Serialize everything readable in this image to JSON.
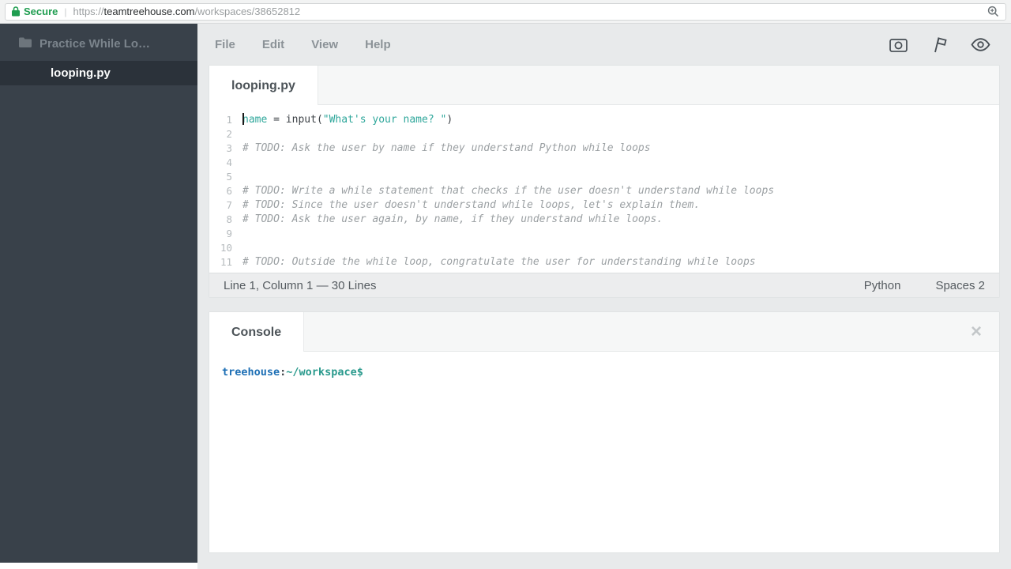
{
  "browser": {
    "secure_label": "Secure",
    "separator": "|",
    "url": {
      "scheme": "https://",
      "domain": "teamtreehouse.com",
      "path": "/workspaces/38652812"
    }
  },
  "sidebar": {
    "project_name": "Practice While Lo…",
    "files": [
      {
        "name": "looping.py"
      }
    ]
  },
  "menubar": {
    "items": [
      "File",
      "Edit",
      "View",
      "Help"
    ]
  },
  "editor": {
    "tab_label": "looping.py",
    "cursor": {
      "line": 1,
      "column": 1
    },
    "lines": [
      {
        "num": 1,
        "segments": [
          {
            "text": "name",
            "type": "name"
          },
          {
            "text": " = ",
            "type": "plain"
          },
          {
            "text": "input",
            "type": "plain"
          },
          {
            "text": "(",
            "type": "plain"
          },
          {
            "text": "\"What's your name? \"",
            "type": "string"
          },
          {
            "text": ")",
            "type": "plain"
          }
        ]
      },
      {
        "num": 2,
        "segments": []
      },
      {
        "num": 3,
        "segments": [
          {
            "text": "# TODO: Ask the user by name if they understand Python while loops",
            "type": "comment"
          }
        ]
      },
      {
        "num": 4,
        "segments": []
      },
      {
        "num": 5,
        "segments": []
      },
      {
        "num": 6,
        "segments": [
          {
            "text": "# TODO: Write a while statement that checks if the user doesn't understand while loops",
            "type": "comment"
          }
        ]
      },
      {
        "num": 7,
        "segments": [
          {
            "text": "# TODO: Since the user doesn't understand while loops, let's explain them.",
            "type": "comment"
          }
        ]
      },
      {
        "num": 8,
        "segments": [
          {
            "text": "# TODO: Ask the user again, by name, if they understand while loops.",
            "type": "comment"
          }
        ]
      },
      {
        "num": 9,
        "segments": []
      },
      {
        "num": 10,
        "segments": []
      },
      {
        "num": 11,
        "segments": [
          {
            "text": "# TODO: Outside the while loop, congratulate the user for understanding while loops",
            "type": "comment"
          }
        ]
      }
    ],
    "status": {
      "left": "Line 1, Column 1 — 30 Lines",
      "language": "Python",
      "indent": "Spaces 2"
    }
  },
  "console": {
    "tab_label": "Console",
    "close_icon": "×",
    "prompt": [
      {
        "text": "treehouse",
        "type": "user"
      },
      {
        "text": ":",
        "type": "plain"
      },
      {
        "text": "~/workspace",
        "type": "path"
      },
      {
        "text": "$",
        "type": "path"
      }
    ]
  },
  "colors": {
    "accent_teal": "#2fa79b",
    "comment_gray": "#9ba0a3",
    "prompt_blue": "#1d6fb5",
    "secure_green": "#1f9d50",
    "sidebar_dark": "#39414a"
  }
}
